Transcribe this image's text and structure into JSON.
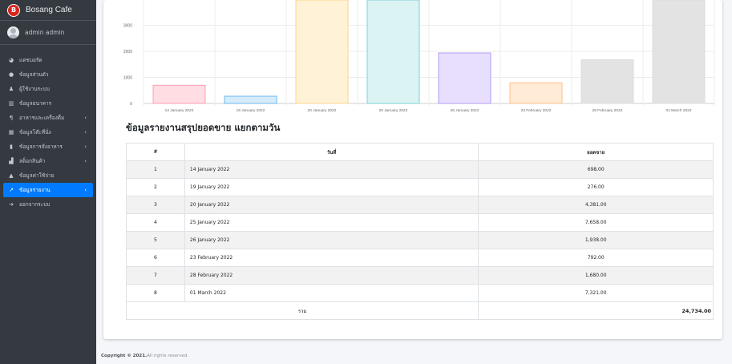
{
  "sidebar": {
    "brand": "Bosang Cafe",
    "brand_logo_text": "B",
    "user": "admin admin",
    "items": [
      {
        "label": "แดชบอร์ด",
        "icon": "dashboard-icon",
        "chevron": false,
        "active": false
      },
      {
        "label": "ข้อมูลส่วนตัว",
        "icon": "user-icon",
        "chevron": false,
        "active": false
      },
      {
        "label": "ผู้ใช้งานระบบ",
        "icon": "users-icon",
        "chevron": false,
        "active": false
      },
      {
        "label": "ข้อมูลธนาคาร",
        "icon": "bank-icon",
        "chevron": false,
        "active": false
      },
      {
        "label": "อาหารและเครื่องดื่ม",
        "icon": "utensils-icon",
        "chevron": true,
        "active": false
      },
      {
        "label": "ข้อมูลโต๊ะที่นั่ง",
        "icon": "table-icon",
        "chevron": true,
        "active": false
      },
      {
        "label": "ข้อมูลการสั่งอาหาร",
        "icon": "order-icon",
        "chevron": true,
        "active": false
      },
      {
        "label": "สต็อกสินค้า",
        "icon": "stock-icon",
        "chevron": true,
        "active": false
      },
      {
        "label": "ข้อมูลค่าใช้จ่าย",
        "icon": "expense-icon",
        "chevron": false,
        "active": false
      },
      {
        "label": "ข้อมูลรายงาน",
        "icon": "report-icon",
        "chevron": true,
        "active": true
      },
      {
        "label": "ออกจากระบบ",
        "icon": "logout-icon",
        "chevron": false,
        "active": false
      }
    ]
  },
  "chart_data": {
    "type": "bar",
    "categories": [
      "14 January 2022",
      "19 January 2022",
      "20 January 2022",
      "25 January 2022",
      "26 January 2022",
      "23 February 2022",
      "28 February 2022",
      "01 March 2022"
    ],
    "values": [
      698,
      276,
      4381,
      7658,
      1938,
      792,
      1680,
      7321
    ],
    "colors": [
      "#ffdde3",
      "#d7ecfb",
      "#fff2d7",
      "#dbf3f3",
      "#e8dfff",
      "#ffebd6",
      "#e3e3e3",
      "#e3e3e3"
    ],
    "borders": [
      "#ff9fb2",
      "#6cb8ee",
      "#ffd48b",
      "#7ed3d3",
      "#b49bf5",
      "#ffbe85",
      "#dcdcdc",
      "#dcdcdc"
    ],
    "yticks": [
      "0",
      "1000",
      "2000",
      "3000"
    ],
    "ylim_visible": [
      0,
      3750
    ]
  },
  "report": {
    "title": "ข้อมูลรายงานสรุปยอดขาย แยกตามวัน",
    "headers": [
      "#",
      "วันที่",
      "ยอดขาย"
    ],
    "rows": [
      [
        "1",
        "14 January 2022",
        "698.00"
      ],
      [
        "2",
        "19 January 2022",
        "276.00"
      ],
      [
        "3",
        "20 January 2022",
        "4,381.00"
      ],
      [
        "4",
        "25 January 2022",
        "7,658.00"
      ],
      [
        "5",
        "26 January 2022",
        "1,938.00"
      ],
      [
        "6",
        "23 February 2022",
        "792.00"
      ],
      [
        "7",
        "28 February 2022",
        "1,680.00"
      ],
      [
        "8",
        "01 March 2022",
        "7,321.00"
      ]
    ],
    "total_label": "รวม",
    "total_value": "24,734.00"
  },
  "footer": {
    "copyright": "Copyright © 2021.",
    "rights": " All rights reserved."
  }
}
